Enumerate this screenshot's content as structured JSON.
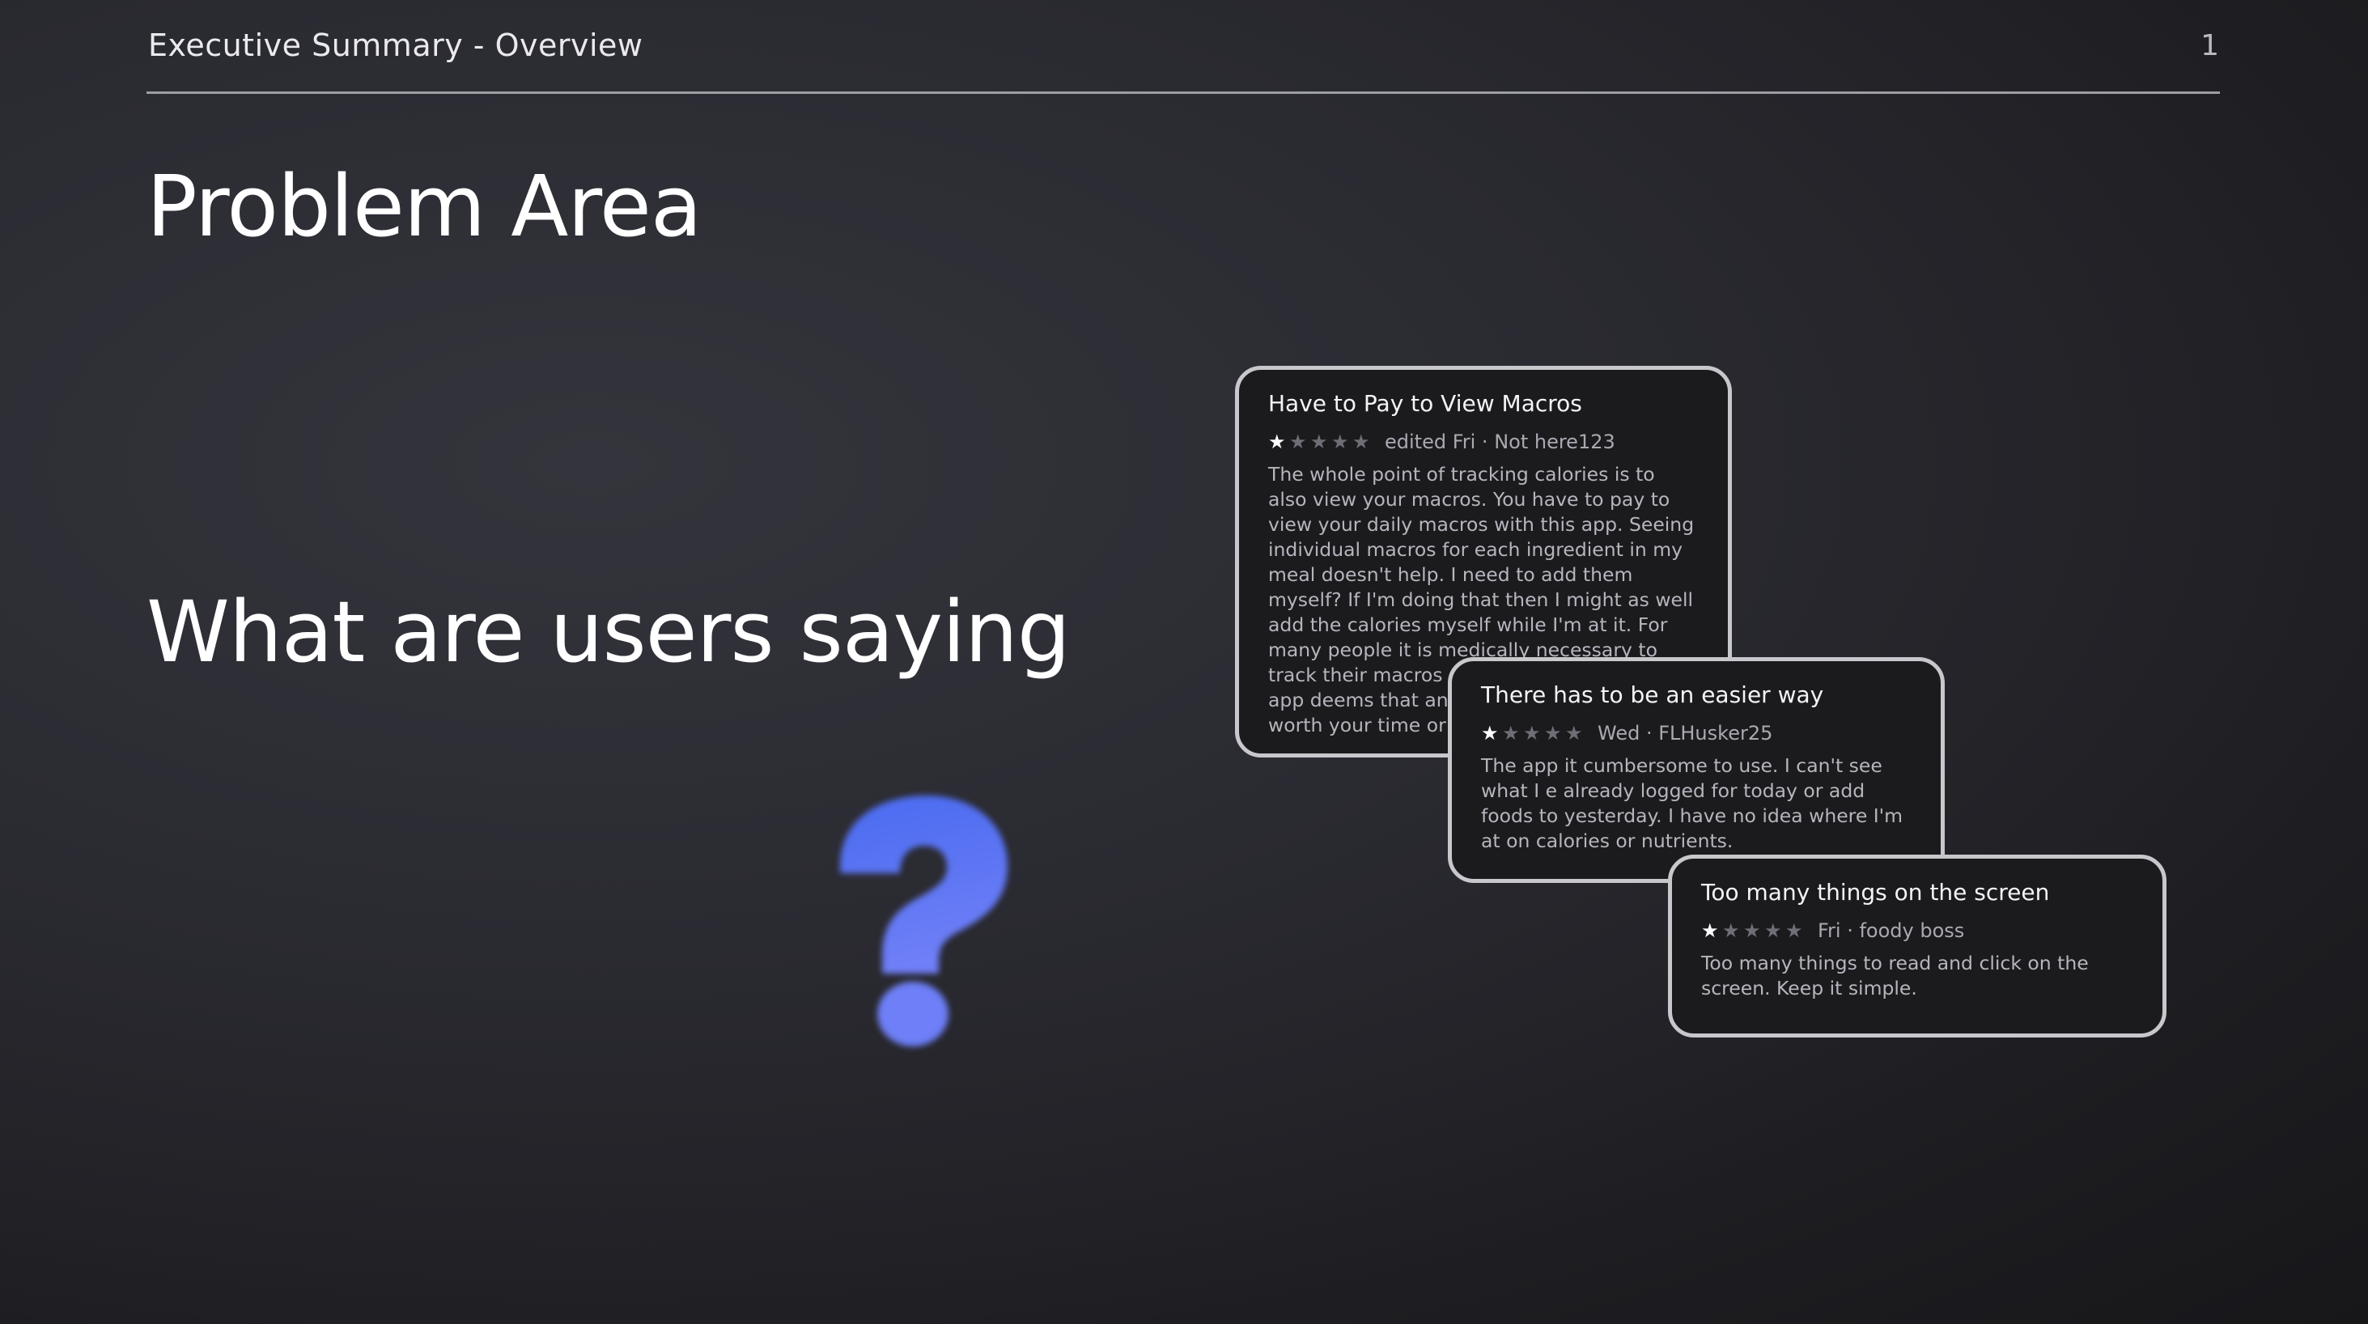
{
  "header": {
    "section_title": "Executive Summary - Overview",
    "page_number": "1"
  },
  "slide": {
    "title": "Problem Area",
    "subtitle": "What are users saying",
    "accent_color": "#5b7cf5"
  },
  "reviews": [
    {
      "title": "Have to Pay to View Macros",
      "rating": 1,
      "max_rating": 5,
      "meta": "edited Fri · Not here123",
      "body": "The whole point of tracking calories is to also view your macros. You have to pay to view your daily macros with this app. Seeing individual macros for each ingredient in my meal doesn't help. I need to add them myself? If I'm doing that then I might as well add the calories myself while I'm at it. For many people it is medically necessary to track their macros and yet somehow this app deems that an unnecessary feature. Not worth your time or money."
    },
    {
      "title": "There has to be an easier way",
      "rating": 1,
      "max_rating": 5,
      "meta": "Wed · FLHusker25",
      "body": "The app it cumbersome to use. I can't see what I e already logged for today or add foods to yesterday. I have no idea where I'm at on calories or nutrients."
    },
    {
      "title": "Too many things on the screen",
      "rating": 1,
      "max_rating": 5,
      "meta": "Fri · foody boss",
      "body": "Too many things to read and click on the screen. Keep it simple."
    }
  ]
}
